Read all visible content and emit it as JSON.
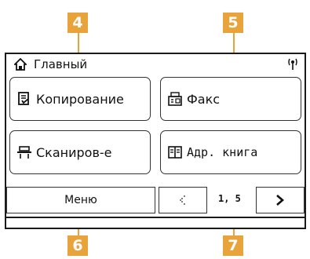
{
  "callouts": {
    "c4": "4",
    "c5": "5",
    "c6": "6",
    "c7": "7"
  },
  "accent_color": "#e8a33a",
  "statusbar": {
    "title": "Главный",
    "home_icon": "home-icon",
    "wireless_icon": "wireless-signal-icon"
  },
  "tiles": {
    "copy": {
      "label": "Копирование",
      "icon": "copy-icon"
    },
    "fax": {
      "label": "Факс",
      "icon": "fax-icon"
    },
    "scan": {
      "label": "Сканиров-е",
      "icon": "scanner-icon"
    },
    "address_book": {
      "label": "Адр. книга",
      "icon": "address-book-icon"
    }
  },
  "bottom": {
    "menu_label": "Меню",
    "page_indicator": "1, 5",
    "prev_icon": "prev-arrow-icon",
    "next_icon": "chevron-right-icon"
  }
}
